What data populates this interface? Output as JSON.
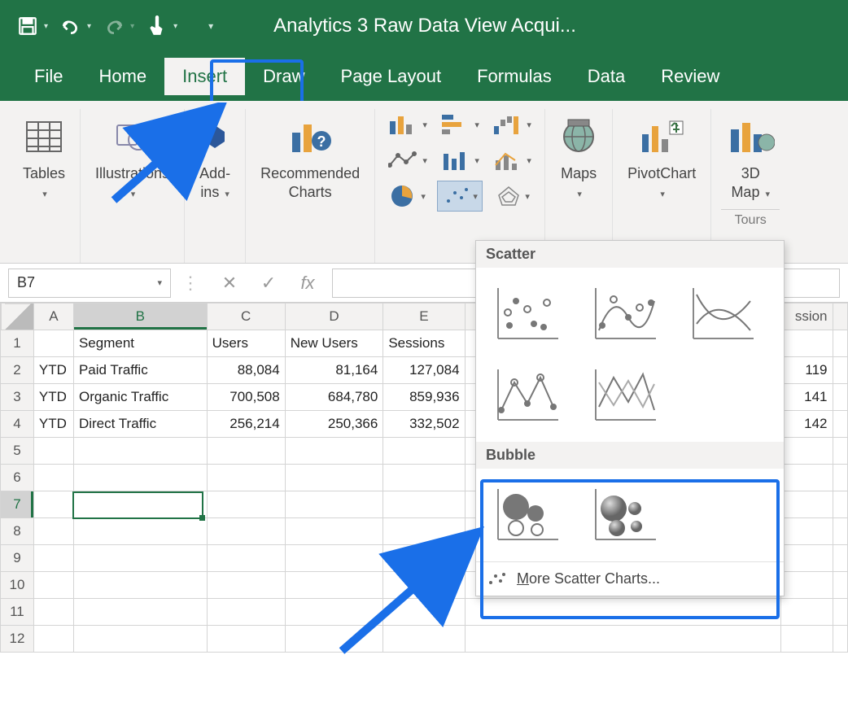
{
  "title": "Analytics 3 Raw Data View Acqui...",
  "tabs": [
    "File",
    "Home",
    "Insert",
    "Draw",
    "Page Layout",
    "Formulas",
    "Data",
    "Review"
  ],
  "active_tab": "Insert",
  "ribbon": {
    "tables": "Tables",
    "illustrations": "Illustrations",
    "addins": "Add-\nins",
    "recommended": "Recommended\nCharts",
    "maps": "Maps",
    "pivotchart": "PivotChart",
    "map3d_l1": "3D",
    "map3d_l2": "Map",
    "tours": "Tours"
  },
  "name_box": "B7",
  "fx_label": "fx",
  "col_headers": [
    "A",
    "B",
    "C",
    "D",
    "E",
    "",
    "",
    "ssion",
    ""
  ],
  "row_numbers": [
    1,
    2,
    3,
    4,
    5,
    6,
    7,
    8,
    9,
    10,
    11,
    12
  ],
  "headers": {
    "b": "Segment",
    "c": "Users",
    "d": "New Users",
    "e": "Sessions"
  },
  "rows": [
    {
      "a": "YTD",
      "b": "Paid Traffic",
      "c": "88,084",
      "d": "81,164",
      "e": "127,084",
      "g": "119"
    },
    {
      "a": "YTD",
      "b": "Organic Traffic",
      "c": "700,508",
      "d": "684,780",
      "e": "859,936",
      "g": "141"
    },
    {
      "a": "YTD",
      "b": "Direct Traffic",
      "c": "256,214",
      "d": "250,366",
      "e": "332,502",
      "g": "142"
    }
  ],
  "dropdown": {
    "scatter_header": "Scatter",
    "bubble_header": "Bubble",
    "more_link_prefix": "M",
    "more_link_rest": "ore Scatter Charts..."
  }
}
